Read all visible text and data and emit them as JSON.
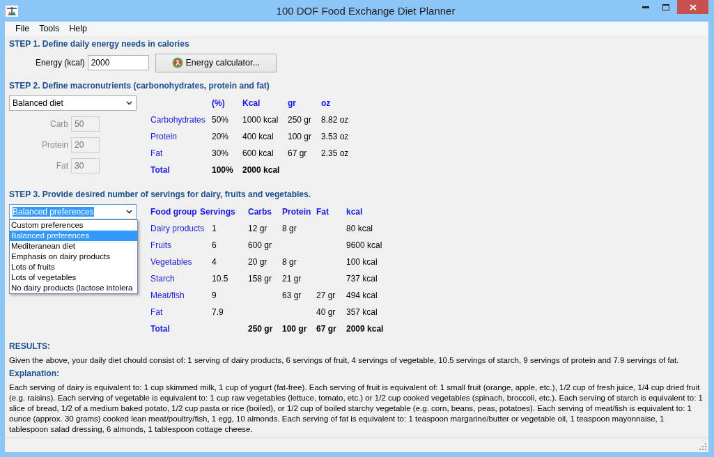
{
  "window": {
    "title": "100 DOF Food Exchange Diet Planner"
  },
  "menu": [
    "File",
    "Tools",
    "Help"
  ],
  "step1": {
    "heading": "STEP 1. Define daily energy needs in calories",
    "energy_label": "Energy (kcal)",
    "energy_value": "2000",
    "calculator_button": "Energy calculator..."
  },
  "step2": {
    "heading": "STEP 2. Define macronutrients (carbonohydrates, protein and fat)",
    "diet_select": "Balanced diet",
    "inputs": [
      {
        "label": "Carb",
        "value": "50",
        "disabled": true
      },
      {
        "label": "Protein",
        "value": "20",
        "disabled": true
      },
      {
        "label": "Fat",
        "value": "30",
        "disabled": true
      }
    ],
    "table": {
      "columns": [
        "(%)",
        "Kcal",
        "gr",
        "oz"
      ],
      "rows": [
        {
          "kind": "item",
          "name": "Carbohydrates",
          "cells": [
            "50%",
            "1000 kcal",
            "250 gr",
            "8.82 oz"
          ]
        },
        {
          "kind": "item",
          "name": "Protein",
          "cells": [
            "20%",
            "400 kcal",
            "100 gr",
            "3.53 oz"
          ]
        },
        {
          "kind": "item",
          "name": "Fat",
          "cells": [
            "30%",
            "600 kcal",
            "67 gr",
            "2.35 oz"
          ]
        },
        {
          "kind": "total",
          "name": "Total",
          "cells": [
            "100%",
            "2000 kcal"
          ]
        }
      ]
    }
  },
  "step3": {
    "heading": "STEP 3. Provide desired number of servings for dairy, fruits and vegetables.",
    "preferences_select": {
      "value": "Balanced preferences",
      "expanded": true,
      "options": [
        {
          "label": "Custom preferences",
          "selected": false
        },
        {
          "label": "Balanced preferences",
          "selected": true
        },
        {
          "label": "Mediteranean diet",
          "selected": false
        },
        {
          "label": "Emphasis on dairy products",
          "selected": false
        },
        {
          "label": "Lots of fruits",
          "selected": false
        },
        {
          "label": "Lots of vegetables",
          "selected": false
        },
        {
          "label": "No dairy products (lactose intolera",
          "selected": false
        }
      ]
    },
    "table": {
      "columns": [
        "Food group",
        "Servings",
        "Carbs",
        "Protein",
        "Fat",
        "kcal"
      ],
      "rows": [
        {
          "kind": "item",
          "group": "Dairy products",
          "servings": "1",
          "carbs": "12 gr",
          "protein": "8 gr",
          "kcal": "80 kcal"
        },
        {
          "kind": "item",
          "group": "Fruits",
          "servings": "6",
          "carbs": "600 gr",
          "kcal": "9600 kcal"
        },
        {
          "kind": "item",
          "group": "Vegetables",
          "servings": "4",
          "carbs": "20 gr",
          "protein": "8 gr",
          "kcal": "100 kcal"
        },
        {
          "kind": "item",
          "group": "Starch",
          "servings": "10.5",
          "carbs": "158 gr",
          "protein": "21 gr",
          "kcal": "737 kcal"
        },
        {
          "kind": "item",
          "group": "Meat/fish",
          "servings": "9",
          "protein": "63 gr",
          "fat": "27 gr",
          "kcal": "494 kcal"
        },
        {
          "kind": "item",
          "group": "Fat",
          "servings": "7.9",
          "fat": "40 gr",
          "kcal": "357 kcal"
        },
        {
          "kind": "total",
          "group": "Total",
          "carbs": "250 gr",
          "protein": "100 gr",
          "fat": "67 gr",
          "kcal": "2009 kcal"
        }
      ]
    }
  },
  "results": {
    "heading": "RESULTS:",
    "text": "Given the above, your daily diet chould consist of: 1 serving of dairy products, 6 servings of fruit, 4 servings of vegetable, 10.5 servings of starch, 9 servings of protein and 7.9 servings of fat.",
    "explanation_heading": "Explanation:",
    "explanation": "Each serving of dairy is equivalent to: 1 cup skimmed milk, 1 cup of yogurt (fat-free). Each serving of fruit is equivalent of: 1 small fruit (orange, apple, etc.), 1/2 cup of fresh juice, 1/4 cup dried fruit (e.g. raisins). Each serving of vegetable is equivalent to: 1 cup raw vegetables (lettuce, tomato, etc.) or 1/2 cup cooked vegetables (spinach, broccoli, etc.). Each serving of starch is equivalent to: 1 slice of bread, 1/2 of a medium baked potato, 1/2 cup pasta or rice (boiled), or 1/2 cup of boiled starchy vegetable (e.g. corn, beans, peas, potatoes). Each serving of meat/fish is equivalent to: 1 ounce (approx. 30 grams) cooked lean meat/poultry/fish, 1 egg, 10 almonds. Each serving of fat is equivalent to: 1 teaspoon margarine/butter or vegetable oil, 1 teaspoon mayonnaise, 1 tablespoon salad dressing, 6 almonds, 1 tablespoon cottage cheese."
  }
}
